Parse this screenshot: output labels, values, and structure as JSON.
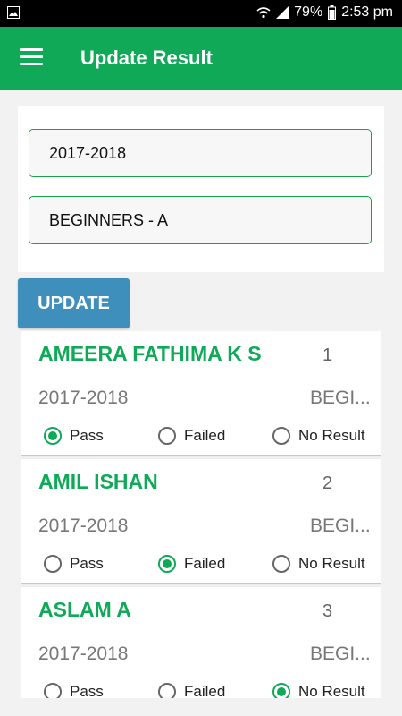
{
  "status": {
    "battery": "79%",
    "time": "2:53 pm"
  },
  "appbar": {
    "title": "Update Result"
  },
  "filters": {
    "year": "2017-2018",
    "class": "BEGINNERS - A"
  },
  "update_label": "UPDATE",
  "options": [
    "Pass",
    "Failed",
    "No Result"
  ],
  "students": [
    {
      "name": "AMEERA FATHIMA K S",
      "no": "1",
      "year": "2017-2018",
      "class": "BEGI...",
      "result": "Pass"
    },
    {
      "name": "AMIL ISHAN",
      "no": "2",
      "year": "2017-2018",
      "class": "BEGI...",
      "result": "Failed"
    },
    {
      "name": "ASLAM A",
      "no": "3",
      "year": "2017-2018",
      "class": "BEGI...",
      "result": "No Result"
    }
  ],
  "colors": {
    "primary": "#0fa958",
    "button": "#3f8fbc"
  }
}
